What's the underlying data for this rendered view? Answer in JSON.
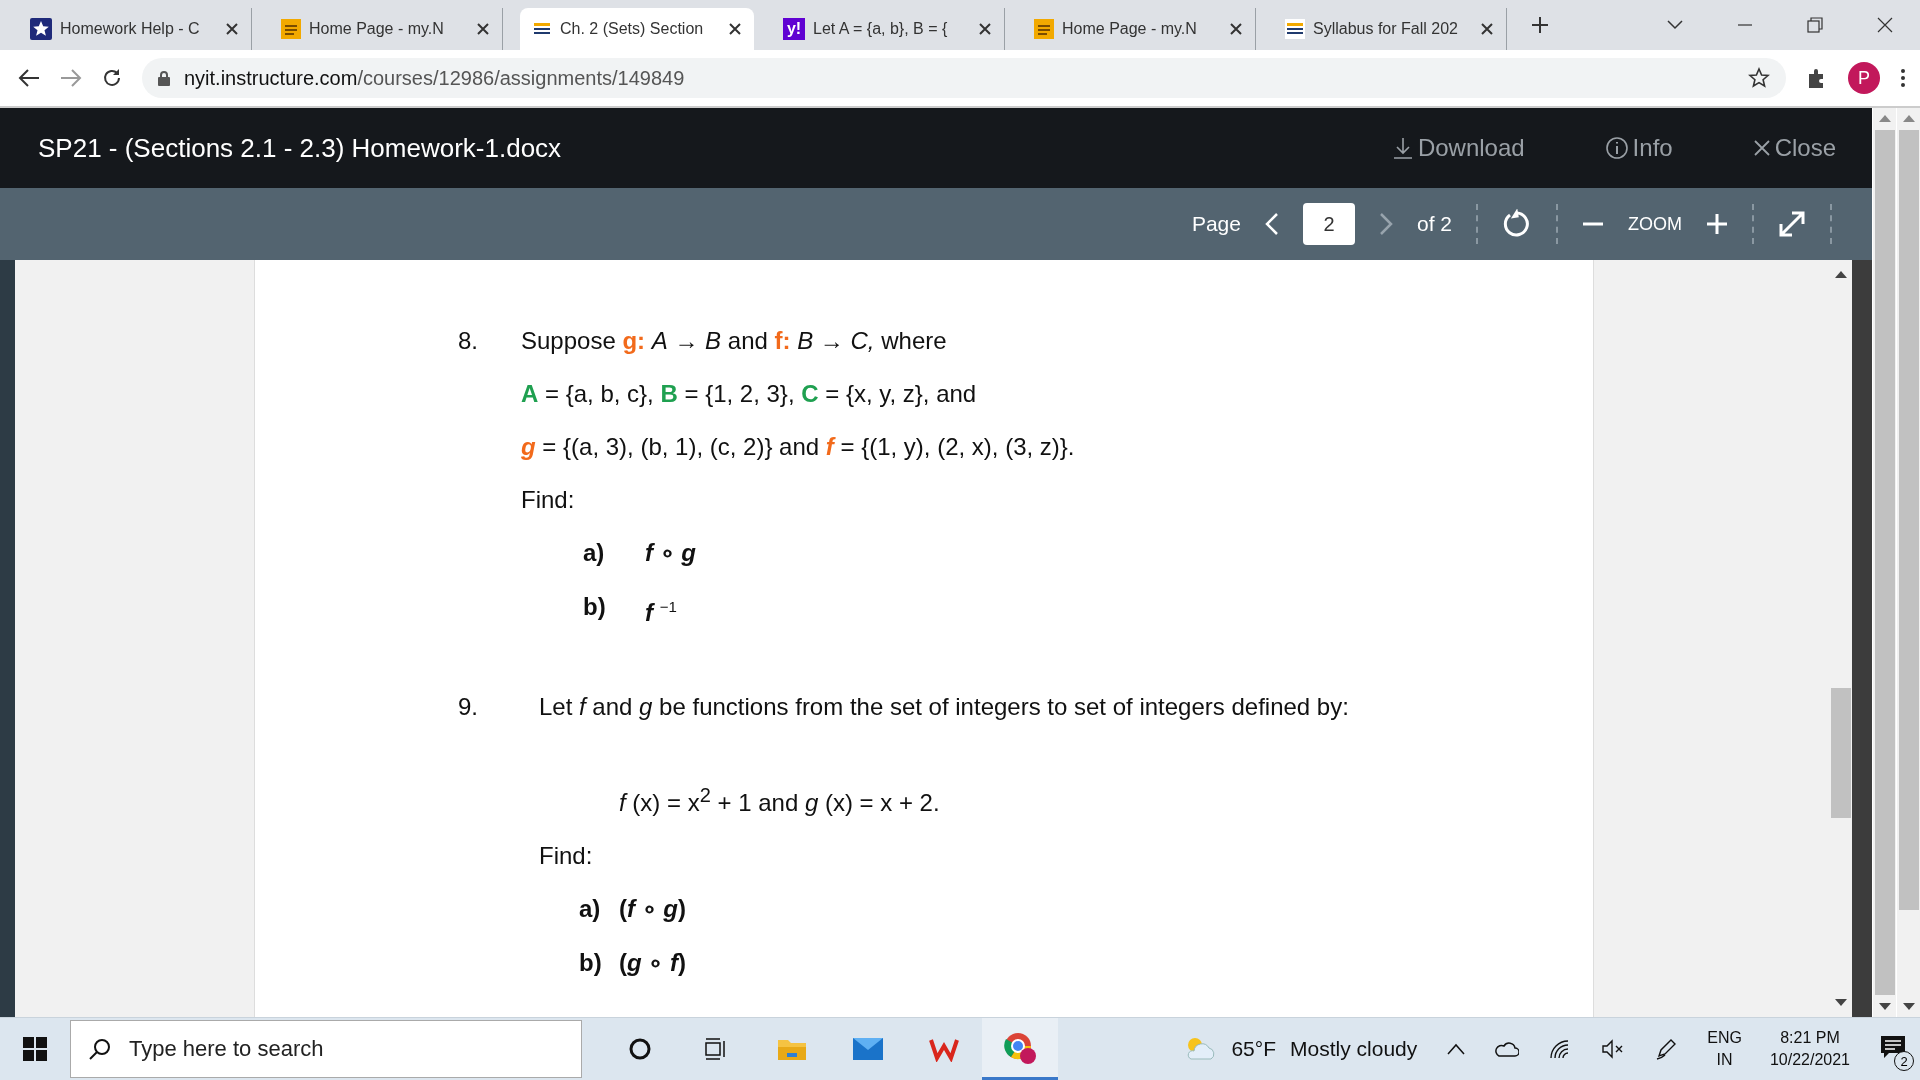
{
  "browser": {
    "tabs": [
      {
        "title": "Homework Help - C",
        "kind": "star",
        "selected": false
      },
      {
        "title": "Home Page - my.N",
        "kind": "square",
        "selected": false
      },
      {
        "title": "Ch. 2 (Sets) Section",
        "kind": "lines",
        "selected": true
      },
      {
        "title": "Let A = {a, b}, B = {",
        "kind": "letters",
        "favicon_text": "y!",
        "selected": false
      },
      {
        "title": "Home Page - my.N",
        "kind": "square",
        "selected": false
      },
      {
        "title": "Syllabus for Fall 202",
        "kind": "lines",
        "selected": false
      }
    ],
    "url_host": "nyit.instructure.com",
    "url_path": "/courses/12986/assignments/149849",
    "profile_initial": "P"
  },
  "viewer": {
    "title": "SP21 - (Sections 2.1 - 2.3) Homework-1.docx",
    "actions": [
      {
        "kind": "download",
        "label": "Download"
      },
      {
        "kind": "info",
        "label": "Info"
      },
      {
        "kind": "close",
        "label": "Close"
      }
    ],
    "toolbar": {
      "page_label": "Page",
      "page_value": "2",
      "page_total": "of 2",
      "zoom_label": "ZOOM"
    }
  },
  "document": {
    "questions": [
      {
        "number": "8.",
        "lines": [
          [
            {
              "text": "Suppose ",
              "kind": "plain"
            },
            {
              "text": "g:",
              "kind": "function"
            },
            {
              "text": " *A* → *B* and ",
              "kind": "plain"
            },
            {
              "text": "f:",
              "kind": "function"
            },
            {
              "text": " *B* → *C,* where",
              "kind": "plain"
            }
          ],
          [
            {
              "text": "A",
              "kind": "set-name"
            },
            {
              "text": " = {a, b, c}, ",
              "kind": "plain"
            },
            {
              "text": "B",
              "kind": "set-name"
            },
            {
              "text": " = {1, 2, 3}, ",
              "kind": "plain"
            },
            {
              "text": "C",
              "kind": "set-name"
            },
            {
              "text": " = {x, y, z}, and",
              "kind": "plain"
            }
          ]
        ],
        "definition": [
          {
            "text": "*g*",
            "kind": "function"
          },
          {
            "text": " = {(a, 3), (b, 1), (c, 2)} and ",
            "kind": "plain"
          },
          {
            "text": "*f*",
            "kind": "function"
          },
          {
            "text": " = {(1, y), (2, x), (3, z)}.",
            "kind": "plain"
          }
        ],
        "find": "Find:",
        "parts": [
          {
            "letter": "a)",
            "expr": "*f* ∘ *g*"
          },
          {
            "letter": "b)",
            "expr": "*f* $^{−1}$"
          }
        ]
      },
      {
        "number": "9.",
        "lines": [
          [
            {
              "text": "Let *f* and *g* be functions from the set of integers to set of integers defined by:",
              "kind": "plain"
            }
          ]
        ],
        "definition": [
          {
            "text": "*f* (x) = x$^{2}$ + 1 and *g* (x) = x + 2.",
            "kind": "plain"
          }
        ],
        "find": "Find:",
        "parts": [
          {
            "letter": "a)",
            "expr": "(*f* ∘ *g*)"
          },
          {
            "letter": "b)",
            "expr": "(*g* ∘ *f*)"
          }
        ]
      }
    ]
  },
  "taskbar": {
    "search_placeholder": "Type here to search",
    "weather_temp": "65°F",
    "weather_text": "Mostly cloudy",
    "language": "ENG",
    "region": "IN",
    "time": "8:21 PM",
    "date": "10/22/2021",
    "notification_count": "2"
  }
}
